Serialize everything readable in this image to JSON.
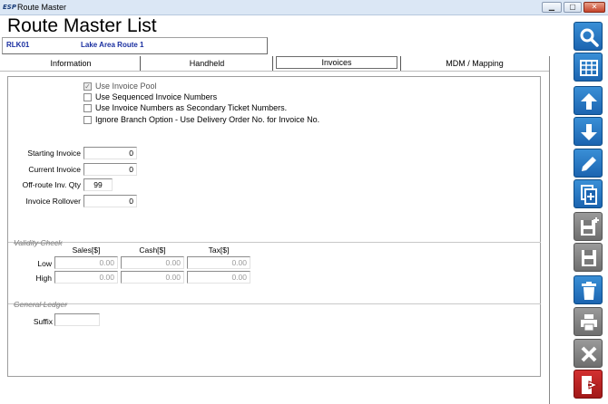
{
  "window": {
    "title": "Route Master",
    "icon_text": "ESP"
  },
  "page": {
    "title": "Route Master List"
  },
  "route": {
    "code": "RLK01",
    "name": "Lake Area Route 1"
  },
  "tabs": [
    {
      "label": "Information",
      "active": false
    },
    {
      "label": "Handheld",
      "active": false
    },
    {
      "label": "Invoices",
      "active": true
    },
    {
      "label": "MDM / Mapping",
      "active": false
    }
  ],
  "options": [
    {
      "label": "Use Invoice Pool",
      "checked": true,
      "enabled": false
    },
    {
      "label": "Use Sequenced Invoice Numbers",
      "checked": false,
      "enabled": true
    },
    {
      "label": "Use Invoice Numbers as Secondary Ticket Numbers.",
      "checked": false,
      "enabled": true
    },
    {
      "label": "Ignore Branch Option - Use Delivery Order No. for Invoice No.",
      "checked": false,
      "enabled": true
    }
  ],
  "invoice_fields": [
    {
      "label": "Starting Invoice",
      "value": "0"
    },
    {
      "label": "Current Invoice",
      "value": "0"
    },
    {
      "label": "Off-route Inv. Qty",
      "value": "99"
    },
    {
      "label": "Invoice Rollover",
      "value": "0"
    }
  ],
  "validity": {
    "section_label": "Validity Check",
    "columns": [
      "Sales[$]",
      "Cash[$]",
      "Tax[$]"
    ],
    "rows": [
      {
        "label": "Low",
        "values": [
          "0.00",
          "0.00",
          "0.00"
        ]
      },
      {
        "label": "High",
        "values": [
          "0.00",
          "0.00",
          "0.00"
        ]
      }
    ]
  },
  "general_ledger": {
    "section_label": "General Ledger",
    "suffix_label": "Suffix",
    "suffix_value": ""
  },
  "toolbar": [
    {
      "name": "search",
      "icon": "magnifier-icon",
      "enabled": true
    },
    {
      "name": "list",
      "icon": "grid-icon",
      "enabled": true
    },
    {
      "name": "previous",
      "icon": "arrow-up-icon",
      "enabled": true
    },
    {
      "name": "next",
      "icon": "arrow-down-icon",
      "enabled": true
    },
    {
      "name": "edit",
      "icon": "pencil-icon",
      "enabled": true
    },
    {
      "name": "copy",
      "icon": "copy-add-icon",
      "enabled": true
    },
    {
      "name": "save-new",
      "icon": "floppy-plus-icon",
      "enabled": false
    },
    {
      "name": "save",
      "icon": "floppy-icon",
      "enabled": false
    },
    {
      "name": "delete",
      "icon": "trash-icon",
      "enabled": true
    },
    {
      "name": "print",
      "icon": "printer-icon",
      "enabled": false
    },
    {
      "name": "cancel",
      "icon": "x-icon",
      "enabled": false
    },
    {
      "name": "exit",
      "icon": "exit-door-icon",
      "enabled": true
    }
  ],
  "colors": {
    "accent": "#1c64b0",
    "route_text": "#1a2fa0",
    "exit": "#a11818",
    "disabled": "#6e6e6e"
  }
}
